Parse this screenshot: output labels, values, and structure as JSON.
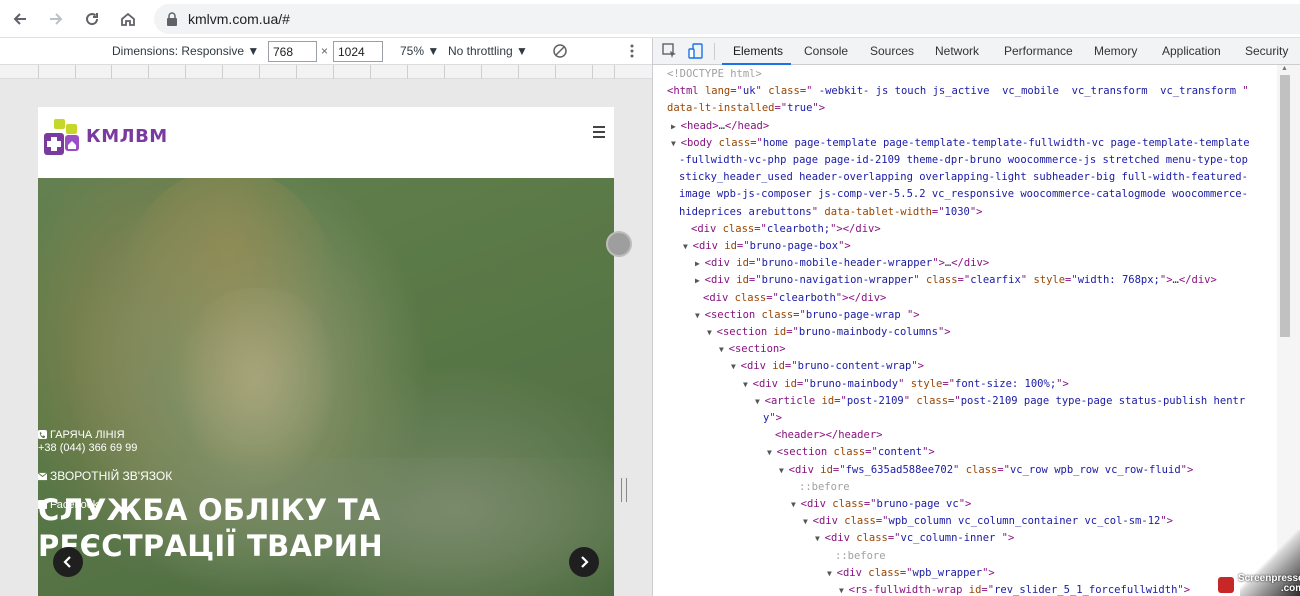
{
  "browser": {
    "url": "kmlvm.com.ua/#",
    "back_icon": "arrow-left-icon",
    "forward_icon": "arrow-right-icon",
    "reload_icon": "reload-icon",
    "home_icon": "home-icon",
    "secure_icon": "lock-icon"
  },
  "device_toolbar": {
    "dimensions_label": "Dimensions: Responsive ▼",
    "width": "768",
    "times": "×",
    "height": "1024",
    "zoom": "75% ▼",
    "throttling": "No throttling ▼"
  },
  "site": {
    "logo_text": "КМЛВМ",
    "hotline_label": "ГАРЯЧА ЛІНІЯ",
    "hotline_phone": "+38 (044) 366 69 99",
    "feedback_label": "ЗВОРОТНІЙ ЗВ'ЯЗОК",
    "facebook_label": "Facebook",
    "hero_title_line1": "СЛУЖБА ОБЛІКУ ТА",
    "hero_title_line2": "РЕЄСТРАЦІЇ ТВАРИН"
  },
  "devtools": {
    "tabs": [
      "Elements",
      "Console",
      "Sources",
      "Network",
      "Performance",
      "Memory",
      "Application",
      "Security"
    ],
    "active_tab": "Elements"
  },
  "dom_lines": [
    {
      "parts": [
        [
          "cm",
          "<!DOCTYPE html>"
        ]
      ]
    },
    {
      "parts": [
        [
          "tag",
          "<html "
        ],
        [
          "an",
          "lang"
        ],
        [
          "tag",
          "=\""
        ],
        [
          "av",
          "uk"
        ],
        [
          "tag",
          "\" "
        ],
        [
          "an",
          "class"
        ],
        [
          "tag",
          "=\""
        ],
        [
          "av",
          " -webkit- js touch js_active  vc_mobile  vc_transform  vc_transform "
        ],
        [
          "tag",
          "\""
        ]
      ]
    },
    {
      "parts": [
        [
          "an",
          "data-lt-installed"
        ],
        [
          "tag",
          "=\""
        ],
        [
          "av",
          "true"
        ],
        [
          "tag",
          "\">"
        ]
      ]
    },
    {
      "parts": [
        [
          "tri",
          "▶"
        ],
        [
          "tag",
          "<head>"
        ],
        [
          "tx",
          "…"
        ],
        [
          "tag",
          "</head>"
        ]
      ]
    },
    {
      "parts": [
        [
          "tri",
          "▼"
        ],
        [
          "tag",
          "<body "
        ],
        [
          "an",
          "class"
        ],
        [
          "tag",
          "=\""
        ],
        [
          "av",
          "home page-template page-template-template-fullwidth-vc page-template-template"
        ]
      ]
    },
    {
      "parts": [
        [
          "av",
          "-fullwidth-vc-php page page-id-2109 theme-dpr-bruno woocommerce-js stretched menu-type-top"
        ]
      ]
    },
    {
      "parts": [
        [
          "av",
          "sticky_header_used header-overlapping overlapping-light subheader-big full-width-featured-"
        ]
      ]
    },
    {
      "parts": [
        [
          "av",
          "image wpb-js-composer js-comp-ver-5.5.2 vc_responsive woocommerce-catalogmode woocommerce-"
        ]
      ]
    },
    {
      "parts": [
        [
          "av",
          "hideprices arebuttons"
        ],
        [
          "tag",
          "\" "
        ],
        [
          "an",
          "data-tablet-width"
        ],
        [
          "tag",
          "=\""
        ],
        [
          "av",
          "1030"
        ],
        [
          "tag",
          "\">"
        ]
      ]
    },
    {
      "parts": [
        [
          "tag",
          "<div "
        ],
        [
          "an",
          "class"
        ],
        [
          "tag",
          "=\""
        ],
        [
          "av",
          "clearboth;"
        ],
        [
          "tag",
          "\"></div>"
        ]
      ]
    },
    {
      "parts": [
        [
          "tri",
          "▼"
        ],
        [
          "tag",
          "<div "
        ],
        [
          "an",
          "id"
        ],
        [
          "tag",
          "=\""
        ],
        [
          "av",
          "bruno-page-box"
        ],
        [
          "tag",
          "\">"
        ]
      ]
    },
    {
      "parts": [
        [
          "tri",
          "▶"
        ],
        [
          "tag",
          "<div "
        ],
        [
          "an",
          "id"
        ],
        [
          "tag",
          "=\""
        ],
        [
          "av",
          "bruno-mobile-header-wrapper"
        ],
        [
          "tag",
          "\">"
        ],
        [
          "tx",
          "…"
        ],
        [
          "tag",
          "</div>"
        ]
      ]
    },
    {
      "parts": [
        [
          "tri",
          "▶"
        ],
        [
          "tag",
          "<div "
        ],
        [
          "an",
          "id"
        ],
        [
          "tag",
          "=\""
        ],
        [
          "av",
          "bruno-navigation-wrapper"
        ],
        [
          "tag",
          "\" "
        ],
        [
          "an",
          "class"
        ],
        [
          "tag",
          "=\""
        ],
        [
          "av",
          "clearfix"
        ],
        [
          "tag",
          "\" "
        ],
        [
          "an",
          "style"
        ],
        [
          "tag",
          "=\""
        ],
        [
          "av",
          "width: 768px;"
        ],
        [
          "tag",
          "\">"
        ],
        [
          "tx",
          "…"
        ],
        [
          "tag",
          "</div>"
        ]
      ]
    },
    {
      "parts": [
        [
          "tag",
          "<div "
        ],
        [
          "an",
          "class"
        ],
        [
          "tag",
          "=\""
        ],
        [
          "av",
          "clearboth"
        ],
        [
          "tag",
          "\"></div>"
        ]
      ]
    },
    {
      "parts": [
        [
          "tri",
          "▼"
        ],
        [
          "tag",
          "<section "
        ],
        [
          "an",
          "class"
        ],
        [
          "tag",
          "=\""
        ],
        [
          "av",
          "bruno-page-wrap "
        ],
        [
          "tag",
          "\">"
        ]
      ]
    },
    {
      "parts": [
        [
          "tri",
          "▼"
        ],
        [
          "tag",
          "<section "
        ],
        [
          "an",
          "id"
        ],
        [
          "tag",
          "=\""
        ],
        [
          "av",
          "bruno-mainbody-columns"
        ],
        [
          "tag",
          "\">"
        ]
      ]
    },
    {
      "parts": [
        [
          "tri",
          "▼"
        ],
        [
          "tag",
          "<section>"
        ]
      ]
    },
    {
      "parts": [
        [
          "tri",
          "▼"
        ],
        [
          "tag",
          "<div "
        ],
        [
          "an",
          "id"
        ],
        [
          "tag",
          "=\""
        ],
        [
          "av",
          "bruno-content-wrap"
        ],
        [
          "tag",
          "\">"
        ]
      ]
    },
    {
      "parts": [
        [
          "tri",
          "▼"
        ],
        [
          "tag",
          "<div "
        ],
        [
          "an",
          "id"
        ],
        [
          "tag",
          "=\""
        ],
        [
          "av",
          "bruno-mainbody"
        ],
        [
          "tag",
          "\" "
        ],
        [
          "an",
          "style"
        ],
        [
          "tag",
          "=\""
        ],
        [
          "av",
          "font-size: 100%;"
        ],
        [
          "tag",
          "\">"
        ]
      ]
    },
    {
      "parts": [
        [
          "tri",
          "▼"
        ],
        [
          "tag",
          "<article "
        ],
        [
          "an",
          "id"
        ],
        [
          "tag",
          "=\""
        ],
        [
          "av",
          "post-2109"
        ],
        [
          "tag",
          "\" "
        ],
        [
          "an",
          "class"
        ],
        [
          "tag",
          "=\""
        ],
        [
          "av",
          "post-2109 page type-page status-publish hentr"
        ]
      ]
    },
    {
      "parts": [
        [
          "av",
          "y"
        ],
        [
          "tag",
          "\">"
        ]
      ]
    },
    {
      "parts": [
        [
          "tag",
          "<header></header>"
        ]
      ]
    },
    {
      "parts": [
        [
          "tri",
          "▼"
        ],
        [
          "tag",
          "<section "
        ],
        [
          "an",
          "class"
        ],
        [
          "tag",
          "=\""
        ],
        [
          "av",
          "content"
        ],
        [
          "tag",
          "\">"
        ]
      ]
    },
    {
      "parts": [
        [
          "tri",
          "▼"
        ],
        [
          "tag",
          "<div "
        ],
        [
          "an",
          "id"
        ],
        [
          "tag",
          "=\""
        ],
        [
          "av",
          "fws_635ad588ee702"
        ],
        [
          "tag",
          "\" "
        ],
        [
          "an",
          "class"
        ],
        [
          "tag",
          "=\""
        ],
        [
          "av",
          "vc_row wpb_row vc_row-fluid"
        ],
        [
          "tag",
          "\">"
        ]
      ]
    },
    {
      "parts": [
        [
          "cm",
          "::before"
        ]
      ]
    },
    {
      "parts": [
        [
          "tri",
          "▼"
        ],
        [
          "tag",
          "<div "
        ],
        [
          "an",
          "class"
        ],
        [
          "tag",
          "=\""
        ],
        [
          "av",
          "bruno-page vc"
        ],
        [
          "tag",
          "\">"
        ]
      ]
    },
    {
      "parts": [
        [
          "tri",
          "▼"
        ],
        [
          "tag",
          "<div "
        ],
        [
          "an",
          "class"
        ],
        [
          "tag",
          "=\""
        ],
        [
          "av",
          "wpb_column vc_column_container vc_col-sm-12"
        ],
        [
          "tag",
          "\">"
        ]
      ]
    },
    {
      "parts": [
        [
          "tri",
          "▼"
        ],
        [
          "tag",
          "<div "
        ],
        [
          "an",
          "class"
        ],
        [
          "tag",
          "=\""
        ],
        [
          "av",
          "vc_column-inner "
        ],
        [
          "tag",
          "\">"
        ]
      ]
    },
    {
      "parts": [
        [
          "cm",
          "::before"
        ]
      ]
    },
    {
      "parts": [
        [
          "tri",
          "▼"
        ],
        [
          "tag",
          "<div "
        ],
        [
          "an",
          "class"
        ],
        [
          "tag",
          "=\""
        ],
        [
          "av",
          "wpb_wrapper"
        ],
        [
          "tag",
          "\">"
        ]
      ]
    },
    {
      "parts": [
        [
          "tri",
          "▼"
        ],
        [
          "tag",
          "<rs-fullwidth-wrap "
        ],
        [
          "an",
          "id"
        ],
        [
          "tag",
          "=\""
        ],
        [
          "av",
          "rev_slider_5_1_forcefullwidth"
        ],
        [
          "tag",
          "\">"
        ]
      ]
    }
  ],
  "watermark": {
    "line1": "Screenpresso",
    "line2": ".com"
  }
}
